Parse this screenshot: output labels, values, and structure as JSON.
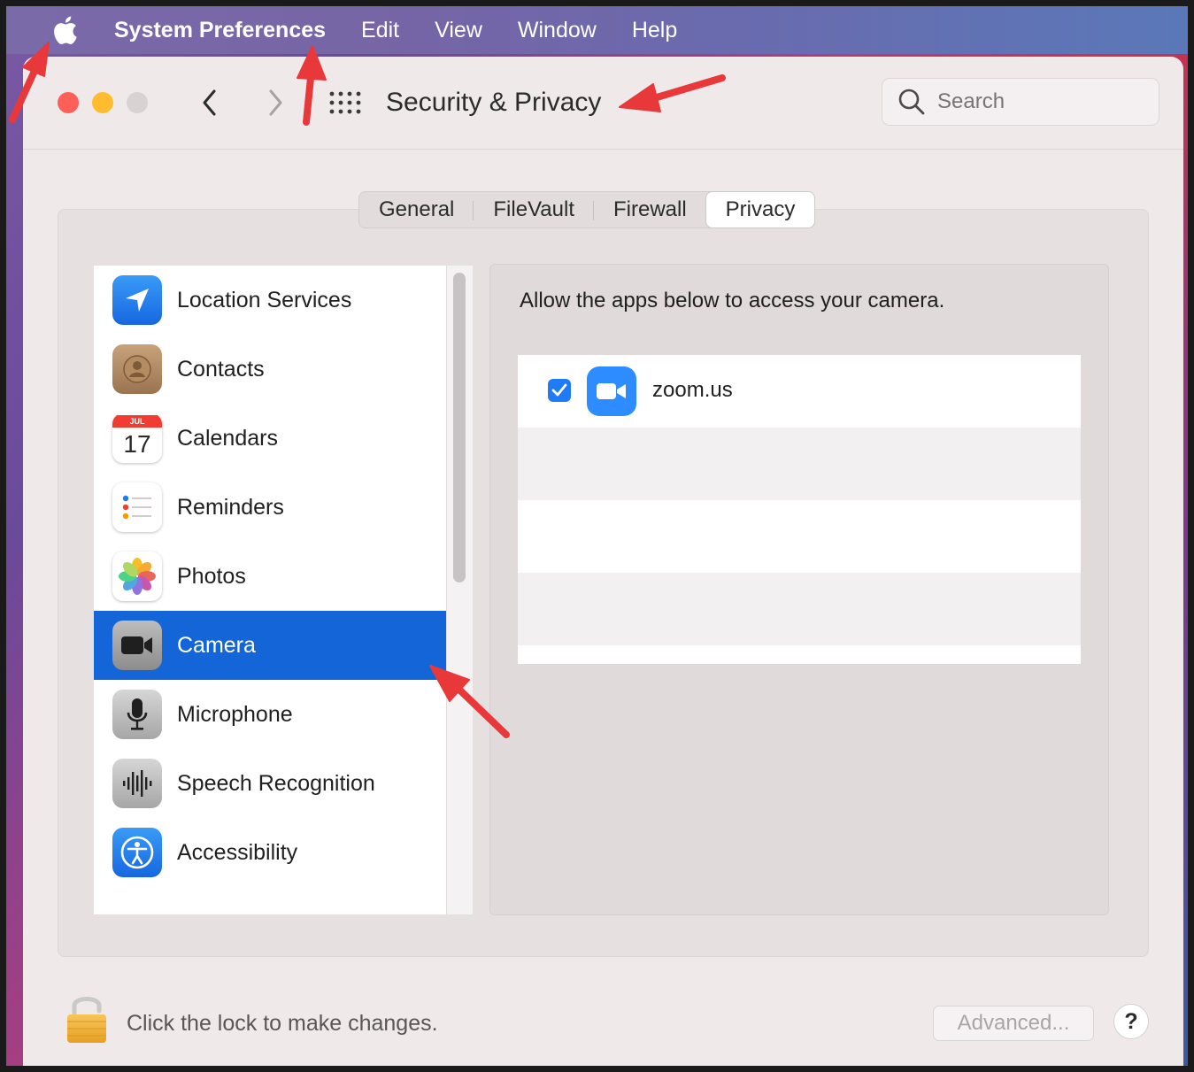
{
  "menubar": {
    "app_name": "System Preferences",
    "items": [
      "Edit",
      "View",
      "Window",
      "Help"
    ]
  },
  "window": {
    "title": "Security & Privacy",
    "search_placeholder": "Search"
  },
  "tabs": [
    "General",
    "FileVault",
    "Firewall",
    "Privacy"
  ],
  "active_tab": "Privacy",
  "privacy_list": [
    {
      "label": "Location Services",
      "icon": "location-icon"
    },
    {
      "label": "Contacts",
      "icon": "contacts-icon"
    },
    {
      "label": "Calendars",
      "icon": "calendar-icon",
      "badge_month": "JUL",
      "badge_day": "17"
    },
    {
      "label": "Reminders",
      "icon": "reminders-icon"
    },
    {
      "label": "Photos",
      "icon": "photos-icon"
    },
    {
      "label": "Camera",
      "icon": "camera-icon",
      "selected": true
    },
    {
      "label": "Microphone",
      "icon": "microphone-icon"
    },
    {
      "label": "Speech Recognition",
      "icon": "speech-recognition-icon"
    },
    {
      "label": "Accessibility",
      "icon": "accessibility-icon"
    }
  ],
  "camera_pane": {
    "description": "Allow the apps below to access your camera.",
    "apps": [
      {
        "name": "zoom.us",
        "checked": true,
        "icon": "zoom-icon"
      }
    ]
  },
  "footer": {
    "lock_text": "Click the lock to make changes.",
    "advanced_label": "Advanced...",
    "help_label": "?"
  },
  "colors": {
    "selection": "#1466d8",
    "checkbox": "#1f7bf5",
    "annotation_arrow": "#e8383a"
  }
}
